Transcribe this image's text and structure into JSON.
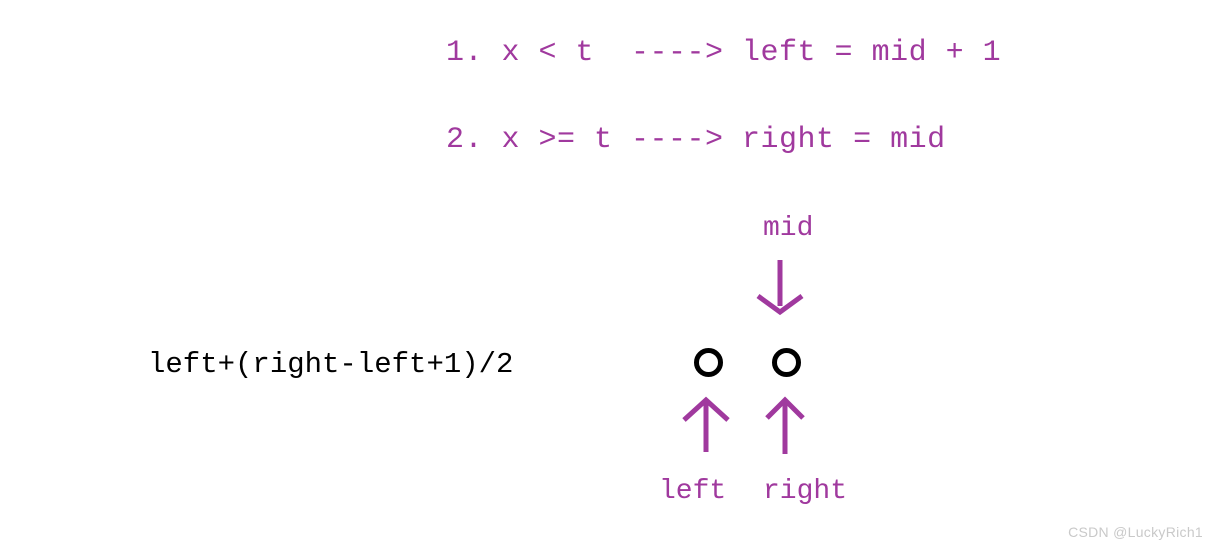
{
  "diagram": {
    "title": "binary search upper-mid rule diagram",
    "accent_color": "#a0399e",
    "node_color": "#000000",
    "formula_color": "#000000",
    "watermark_color": "#c9c9c9",
    "background_color": "#ffffff"
  },
  "rules": [
    {
      "id": "rule-1",
      "text": "1. x < t  ----> left = mid + 1"
    },
    {
      "id": "rule-2",
      "text": "2. x >= t ----> right = mid"
    }
  ],
  "formula": {
    "text": "left+(right-left+1)/2"
  },
  "pointers": {
    "mid_label": "mid",
    "left_label": "left",
    "right_label": "right"
  },
  "nodes": [
    {
      "name": "node-left",
      "shape": "circle-outline"
    },
    {
      "name": "node-right",
      "shape": "circle-outline"
    }
  ],
  "arrows": {
    "mid_down": "down-arrow-icon",
    "left_up": "up-arrow-icon",
    "right_up": "up-arrow-icon"
  },
  "watermark": {
    "text": "CSDN @LuckyRich1"
  }
}
